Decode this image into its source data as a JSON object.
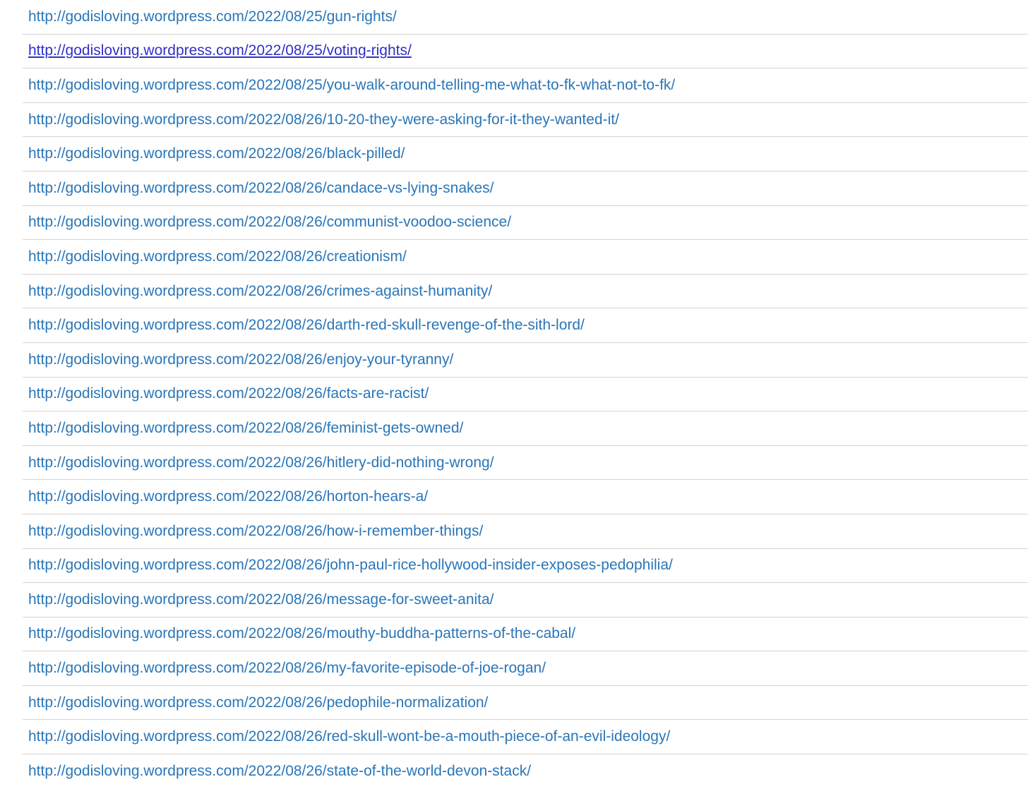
{
  "links": [
    {
      "text": "http://godisloving.wordpress.com/2022/08/25/gun-rights/",
      "hovered": false
    },
    {
      "text": "http://godisloving.wordpress.com/2022/08/25/voting-rights/",
      "hovered": true
    },
    {
      "text": "http://godisloving.wordpress.com/2022/08/25/you-walk-around-telling-me-what-to-fk-what-not-to-fk/",
      "hovered": false
    },
    {
      "text": "http://godisloving.wordpress.com/2022/08/26/10-20-they-were-asking-for-it-they-wanted-it/",
      "hovered": false
    },
    {
      "text": "http://godisloving.wordpress.com/2022/08/26/black-pilled/",
      "hovered": false
    },
    {
      "text": "http://godisloving.wordpress.com/2022/08/26/candace-vs-lying-snakes/",
      "hovered": false
    },
    {
      "text": "http://godisloving.wordpress.com/2022/08/26/communist-voodoo-science/",
      "hovered": false
    },
    {
      "text": "http://godisloving.wordpress.com/2022/08/26/creationism/",
      "hovered": false
    },
    {
      "text": "http://godisloving.wordpress.com/2022/08/26/crimes-against-humanity/",
      "hovered": false
    },
    {
      "text": "http://godisloving.wordpress.com/2022/08/26/darth-red-skull-revenge-of-the-sith-lord/",
      "hovered": false
    },
    {
      "text": "http://godisloving.wordpress.com/2022/08/26/enjoy-your-tyranny/",
      "hovered": false
    },
    {
      "text": "http://godisloving.wordpress.com/2022/08/26/facts-are-racist/",
      "hovered": false
    },
    {
      "text": "http://godisloving.wordpress.com/2022/08/26/feminist-gets-owned/",
      "hovered": false
    },
    {
      "text": "http://godisloving.wordpress.com/2022/08/26/hitlery-did-nothing-wrong/",
      "hovered": false
    },
    {
      "text": "http://godisloving.wordpress.com/2022/08/26/horton-hears-a/",
      "hovered": false
    },
    {
      "text": "http://godisloving.wordpress.com/2022/08/26/how-i-remember-things/",
      "hovered": false
    },
    {
      "text": "http://godisloving.wordpress.com/2022/08/26/john-paul-rice-hollywood-insider-exposes-pedophilia/",
      "hovered": false
    },
    {
      "text": "http://godisloving.wordpress.com/2022/08/26/message-for-sweet-anita/",
      "hovered": false
    },
    {
      "text": "http://godisloving.wordpress.com/2022/08/26/mouthy-buddha-patterns-of-the-cabal/",
      "hovered": false
    },
    {
      "text": "http://godisloving.wordpress.com/2022/08/26/my-favorite-episode-of-joe-rogan/",
      "hovered": false
    },
    {
      "text": "http://godisloving.wordpress.com/2022/08/26/pedophile-normalization/",
      "hovered": false
    },
    {
      "text": "http://godisloving.wordpress.com/2022/08/26/red-skull-wont-be-a-mouth-piece-of-an-evil-ideology/",
      "hovered": false
    },
    {
      "text": "http://godisloving.wordpress.com/2022/08/26/state-of-the-world-devon-stack/",
      "hovered": false
    }
  ],
  "colors": {
    "link": "#2a76b8",
    "link_hover": "#3030c8",
    "divider": "#d4d4d4",
    "background": "#ffffff"
  }
}
